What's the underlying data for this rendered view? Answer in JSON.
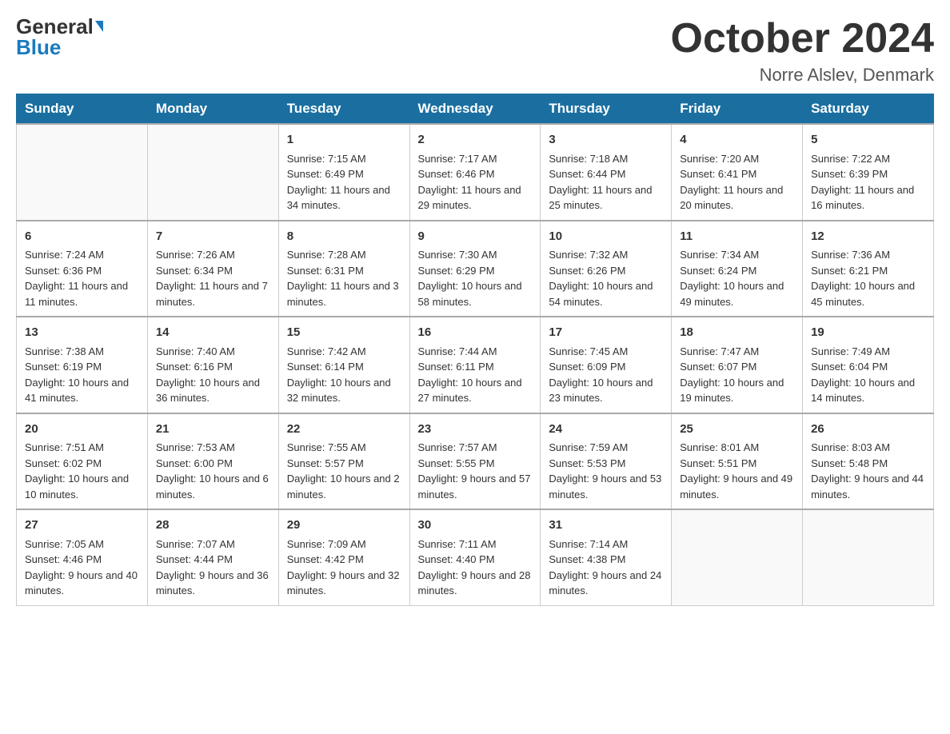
{
  "logo": {
    "general": "General",
    "blue": "Blue"
  },
  "title": "October 2024",
  "location": "Norre Alslev, Denmark",
  "headers": [
    "Sunday",
    "Monday",
    "Tuesday",
    "Wednesday",
    "Thursday",
    "Friday",
    "Saturday"
  ],
  "weeks": [
    [
      {
        "day": "",
        "sunrise": "",
        "sunset": "",
        "daylight": ""
      },
      {
        "day": "",
        "sunrise": "",
        "sunset": "",
        "daylight": ""
      },
      {
        "day": "1",
        "sunrise": "Sunrise: 7:15 AM",
        "sunset": "Sunset: 6:49 PM",
        "daylight": "Daylight: 11 hours and 34 minutes."
      },
      {
        "day": "2",
        "sunrise": "Sunrise: 7:17 AM",
        "sunset": "Sunset: 6:46 PM",
        "daylight": "Daylight: 11 hours and 29 minutes."
      },
      {
        "day": "3",
        "sunrise": "Sunrise: 7:18 AM",
        "sunset": "Sunset: 6:44 PM",
        "daylight": "Daylight: 11 hours and 25 minutes."
      },
      {
        "day": "4",
        "sunrise": "Sunrise: 7:20 AM",
        "sunset": "Sunset: 6:41 PM",
        "daylight": "Daylight: 11 hours and 20 minutes."
      },
      {
        "day": "5",
        "sunrise": "Sunrise: 7:22 AM",
        "sunset": "Sunset: 6:39 PM",
        "daylight": "Daylight: 11 hours and 16 minutes."
      }
    ],
    [
      {
        "day": "6",
        "sunrise": "Sunrise: 7:24 AM",
        "sunset": "Sunset: 6:36 PM",
        "daylight": "Daylight: 11 hours and 11 minutes."
      },
      {
        "day": "7",
        "sunrise": "Sunrise: 7:26 AM",
        "sunset": "Sunset: 6:34 PM",
        "daylight": "Daylight: 11 hours and 7 minutes."
      },
      {
        "day": "8",
        "sunrise": "Sunrise: 7:28 AM",
        "sunset": "Sunset: 6:31 PM",
        "daylight": "Daylight: 11 hours and 3 minutes."
      },
      {
        "day": "9",
        "sunrise": "Sunrise: 7:30 AM",
        "sunset": "Sunset: 6:29 PM",
        "daylight": "Daylight: 10 hours and 58 minutes."
      },
      {
        "day": "10",
        "sunrise": "Sunrise: 7:32 AM",
        "sunset": "Sunset: 6:26 PM",
        "daylight": "Daylight: 10 hours and 54 minutes."
      },
      {
        "day": "11",
        "sunrise": "Sunrise: 7:34 AM",
        "sunset": "Sunset: 6:24 PM",
        "daylight": "Daylight: 10 hours and 49 minutes."
      },
      {
        "day": "12",
        "sunrise": "Sunrise: 7:36 AM",
        "sunset": "Sunset: 6:21 PM",
        "daylight": "Daylight: 10 hours and 45 minutes."
      }
    ],
    [
      {
        "day": "13",
        "sunrise": "Sunrise: 7:38 AM",
        "sunset": "Sunset: 6:19 PM",
        "daylight": "Daylight: 10 hours and 41 minutes."
      },
      {
        "day": "14",
        "sunrise": "Sunrise: 7:40 AM",
        "sunset": "Sunset: 6:16 PM",
        "daylight": "Daylight: 10 hours and 36 minutes."
      },
      {
        "day": "15",
        "sunrise": "Sunrise: 7:42 AM",
        "sunset": "Sunset: 6:14 PM",
        "daylight": "Daylight: 10 hours and 32 minutes."
      },
      {
        "day": "16",
        "sunrise": "Sunrise: 7:44 AM",
        "sunset": "Sunset: 6:11 PM",
        "daylight": "Daylight: 10 hours and 27 minutes."
      },
      {
        "day": "17",
        "sunrise": "Sunrise: 7:45 AM",
        "sunset": "Sunset: 6:09 PM",
        "daylight": "Daylight: 10 hours and 23 minutes."
      },
      {
        "day": "18",
        "sunrise": "Sunrise: 7:47 AM",
        "sunset": "Sunset: 6:07 PM",
        "daylight": "Daylight: 10 hours and 19 minutes."
      },
      {
        "day": "19",
        "sunrise": "Sunrise: 7:49 AM",
        "sunset": "Sunset: 6:04 PM",
        "daylight": "Daylight: 10 hours and 14 minutes."
      }
    ],
    [
      {
        "day": "20",
        "sunrise": "Sunrise: 7:51 AM",
        "sunset": "Sunset: 6:02 PM",
        "daylight": "Daylight: 10 hours and 10 minutes."
      },
      {
        "day": "21",
        "sunrise": "Sunrise: 7:53 AM",
        "sunset": "Sunset: 6:00 PM",
        "daylight": "Daylight: 10 hours and 6 minutes."
      },
      {
        "day": "22",
        "sunrise": "Sunrise: 7:55 AM",
        "sunset": "Sunset: 5:57 PM",
        "daylight": "Daylight: 10 hours and 2 minutes."
      },
      {
        "day": "23",
        "sunrise": "Sunrise: 7:57 AM",
        "sunset": "Sunset: 5:55 PM",
        "daylight": "Daylight: 9 hours and 57 minutes."
      },
      {
        "day": "24",
        "sunrise": "Sunrise: 7:59 AM",
        "sunset": "Sunset: 5:53 PM",
        "daylight": "Daylight: 9 hours and 53 minutes."
      },
      {
        "day": "25",
        "sunrise": "Sunrise: 8:01 AM",
        "sunset": "Sunset: 5:51 PM",
        "daylight": "Daylight: 9 hours and 49 minutes."
      },
      {
        "day": "26",
        "sunrise": "Sunrise: 8:03 AM",
        "sunset": "Sunset: 5:48 PM",
        "daylight": "Daylight: 9 hours and 44 minutes."
      }
    ],
    [
      {
        "day": "27",
        "sunrise": "Sunrise: 7:05 AM",
        "sunset": "Sunset: 4:46 PM",
        "daylight": "Daylight: 9 hours and 40 minutes."
      },
      {
        "day": "28",
        "sunrise": "Sunrise: 7:07 AM",
        "sunset": "Sunset: 4:44 PM",
        "daylight": "Daylight: 9 hours and 36 minutes."
      },
      {
        "day": "29",
        "sunrise": "Sunrise: 7:09 AM",
        "sunset": "Sunset: 4:42 PM",
        "daylight": "Daylight: 9 hours and 32 minutes."
      },
      {
        "day": "30",
        "sunrise": "Sunrise: 7:11 AM",
        "sunset": "Sunset: 4:40 PM",
        "daylight": "Daylight: 9 hours and 28 minutes."
      },
      {
        "day": "31",
        "sunrise": "Sunrise: 7:14 AM",
        "sunset": "Sunset: 4:38 PM",
        "daylight": "Daylight: 9 hours and 24 minutes."
      },
      {
        "day": "",
        "sunrise": "",
        "sunset": "",
        "daylight": ""
      },
      {
        "day": "",
        "sunrise": "",
        "sunset": "",
        "daylight": ""
      }
    ]
  ]
}
